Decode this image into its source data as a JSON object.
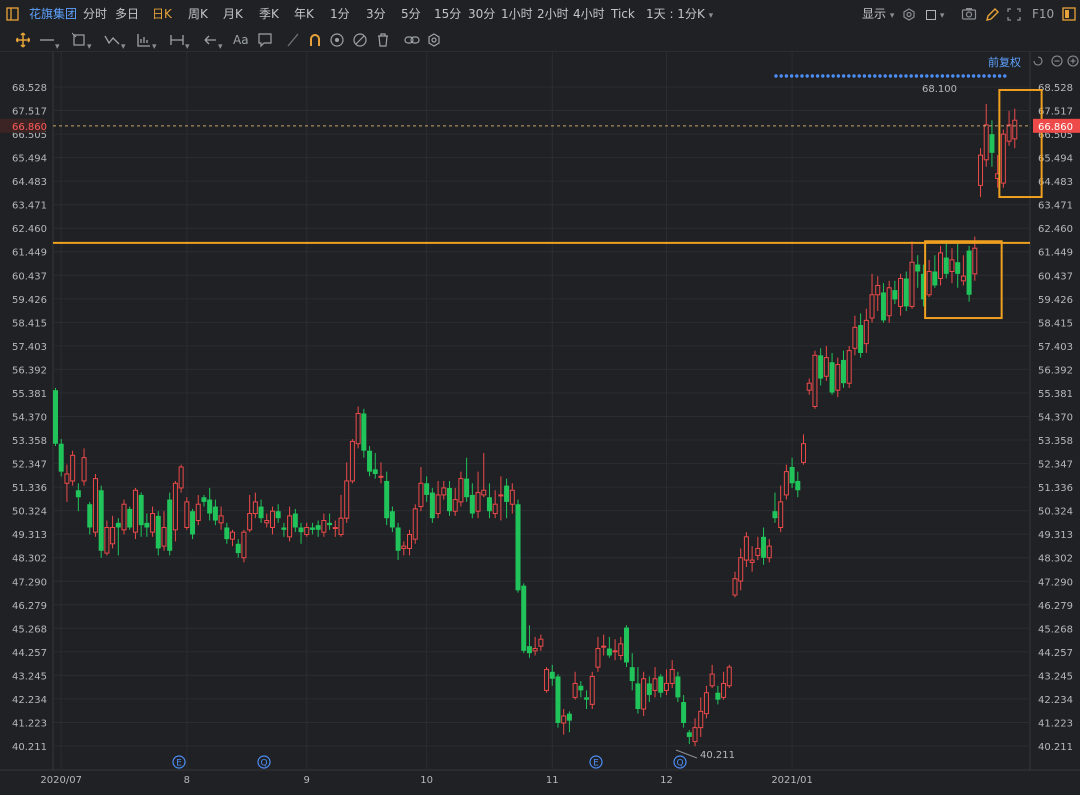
{
  "topbar": {
    "title": "花旗集团",
    "periods": [
      "分时",
      "多日",
      "日K",
      "周K",
      "月K",
      "季K",
      "年K",
      "1分",
      "3分",
      "5分",
      "15分",
      "30分",
      "1小时",
      "2小时",
      "4小时",
      "Tick"
    ],
    "active_period": "日K",
    "interval_select": "1天 : 1分K",
    "display_label": "显示",
    "f10_label": "F10"
  },
  "toolbar": {
    "text_tool_label": "Aa",
    "icons": [
      "move-icon",
      "line-icon",
      "rect-icon",
      "trend-icon",
      "chart-icon",
      "range-icon",
      "arrow-icon",
      "text-icon",
      "note-icon",
      "pen-icon",
      "magnet-icon",
      "eye-icon",
      "hide-icon",
      "trash-icon",
      "link-icon",
      "gear-icon"
    ]
  },
  "chart": {
    "adjust_label": "前复权",
    "current_price": "66.860",
    "max_label": "68.100",
    "min_label": "40.211",
    "resistance_level": 61.83,
    "event_markers": [
      {
        "glyph": "E",
        "x_index": 1
      },
      {
        "glyph": "Q",
        "x_index": 2
      },
      {
        "glyph": "E",
        "x_index": 3
      },
      {
        "glyph": "Q",
        "x_index": 4
      }
    ],
    "colors": {
      "up": "#ec4a4a",
      "down": "#20c45b",
      "highlight": "#f0a020",
      "accent_blue": "#4d8ef5"
    }
  },
  "chart_data": {
    "type": "candlestick",
    "y_ticks": [
      "68.528",
      "67.517",
      "66.505",
      "65.494",
      "64.483",
      "63.471",
      "62.460",
      "61.449",
      "60.437",
      "59.426",
      "58.415",
      "57.403",
      "56.392",
      "55.381",
      "54.370",
      "53.358",
      "52.347",
      "51.336",
      "50.324",
      "49.313",
      "48.302",
      "47.290",
      "46.279",
      "45.268",
      "44.257",
      "43.245",
      "42.234",
      "41.223",
      "40.211"
    ],
    "ylim": [
      40.211,
      68.528
    ],
    "x_ticks": [
      {
        "label": "2020/07",
        "date": "2020-07-01"
      },
      {
        "label": "8",
        "date": "2020-08-03"
      },
      {
        "label": "9",
        "date": "2020-09-01"
      },
      {
        "label": "10",
        "date": "2020-10-01"
      },
      {
        "label": "11",
        "date": "2020-11-02"
      },
      {
        "label": "12",
        "date": "2020-12-01"
      },
      {
        "label": "2021/01",
        "date": "2021-01-04"
      }
    ],
    "candles": [
      [
        55.5,
        53.2,
        55.6,
        53.1
      ],
      [
        53.2,
        52.0,
        53.4,
        51.8
      ],
      [
        51.5,
        51.9,
        52.3,
        50.7
      ],
      [
        51.6,
        52.7,
        52.9,
        51.4
      ],
      [
        51.2,
        50.9,
        51.5,
        50.3
      ],
      [
        51.6,
        52.6,
        53.0,
        51.4
      ],
      [
        50.6,
        49.6,
        50.7,
        49.3
      ],
      [
        49.4,
        51.7,
        51.9,
        49.2
      ],
      [
        51.2,
        48.6,
        51.4,
        48.3
      ],
      [
        48.5,
        49.6,
        49.9,
        48.4
      ],
      [
        48.9,
        49.6,
        50.1,
        48.7
      ],
      [
        49.8,
        49.6,
        50.0,
        48.4
      ],
      [
        49.5,
        50.6,
        50.8,
        49.3
      ],
      [
        50.4,
        49.6,
        50.5,
        49.5
      ],
      [
        49.4,
        51.2,
        51.3,
        49.1
      ],
      [
        51.0,
        49.7,
        51.1,
        49.2
      ],
      [
        49.8,
        49.6,
        50.2,
        49.2
      ],
      [
        49.4,
        50.2,
        50.5,
        49.2
      ],
      [
        50.1,
        48.7,
        50.3,
        48.4
      ],
      [
        48.8,
        49.6,
        50.3,
        48.6
      ],
      [
        50.8,
        48.6,
        51.1,
        48.4
      ],
      [
        49.5,
        51.5,
        51.6,
        49.0
      ],
      [
        51.3,
        52.2,
        52.3,
        51.1
      ],
      [
        49.6,
        50.7,
        50.9,
        49.5
      ],
      [
        50.3,
        49.3,
        50.4,
        49.1
      ],
      [
        49.9,
        50.6,
        51.0,
        49.7
      ],
      [
        50.9,
        50.7,
        51.0,
        50.5
      ],
      [
        50.8,
        50.2,
        51.3,
        49.9
      ],
      [
        50.5,
        49.9,
        50.8,
        49.7
      ],
      [
        49.8,
        50.1,
        50.5,
        49.5
      ],
      [
        49.6,
        49.1,
        49.8,
        48.9
      ],
      [
        49.1,
        49.4,
        49.5,
        48.8
      ],
      [
        48.9,
        48.5,
        49.1,
        48.3
      ],
      [
        48.3,
        49.4,
        49.5,
        48.1
      ],
      [
        49.5,
        50.2,
        51.0,
        49.4
      ],
      [
        50.2,
        50.7,
        51.1,
        50.0
      ],
      [
        50.5,
        50.0,
        50.8,
        49.8
      ],
      [
        49.8,
        49.9,
        50.2,
        49.6
      ],
      [
        49.6,
        50.3,
        50.5,
        49.3
      ],
      [
        50.3,
        50.0,
        50.6,
        49.8
      ],
      [
        49.6,
        49.5,
        49.8,
        49.2
      ],
      [
        49.2,
        50.1,
        50.5,
        49.0
      ],
      [
        50.2,
        49.6,
        50.4,
        49.4
      ],
      [
        49.6,
        49.4,
        49.8,
        48.9
      ],
      [
        49.3,
        49.6,
        49.8,
        49.2
      ],
      [
        49.6,
        49.5,
        49.8,
        49.3
      ],
      [
        49.7,
        49.5,
        49.9,
        49.2
      ],
      [
        49.4,
        49.9,
        50.2,
        49.2
      ],
      [
        49.8,
        49.7,
        50.2,
        49.5
      ],
      [
        49.6,
        49.6,
        49.9,
        49.2
      ],
      [
        49.3,
        50.0,
        51.0,
        49.2
      ],
      [
        50.0,
        51.6,
        52.4,
        49.8
      ],
      [
        51.6,
        53.3,
        53.4,
        51.5
      ],
      [
        53.2,
        54.5,
        54.8,
        53.0
      ],
      [
        54.5,
        52.9,
        54.7,
        52.6
      ],
      [
        52.9,
        52.0,
        53.1,
        51.8
      ],
      [
        52.1,
        51.9,
        52.8,
        51.7
      ],
      [
        51.8,
        51.8,
        52.4,
        51.5
      ],
      [
        51.6,
        50.0,
        52.0,
        49.7
      ],
      [
        50.3,
        49.6,
        50.5,
        49.4
      ],
      [
        49.6,
        48.6,
        49.8,
        48.2
      ],
      [
        48.7,
        48.8,
        49.0,
        48.4
      ],
      [
        48.7,
        49.3,
        49.5,
        48.4
      ],
      [
        49.1,
        50.4,
        50.6,
        48.9
      ],
      [
        50.5,
        51.5,
        52.2,
        50.3
      ],
      [
        51.5,
        51.0,
        51.8,
        50.7
      ],
      [
        51.1,
        50.0,
        51.3,
        49.8
      ],
      [
        50.2,
        51.0,
        51.6,
        50.0
      ],
      [
        51.0,
        51.3,
        51.6,
        50.8
      ],
      [
        51.3,
        50.3,
        51.6,
        50.1
      ],
      [
        50.3,
        50.8,
        51.3,
        50.1
      ],
      [
        50.7,
        51.7,
        52.0,
        50.5
      ],
      [
        51.7,
        50.9,
        52.6,
        50.7
      ],
      [
        51.0,
        50.2,
        51.5,
        50.0
      ],
      [
        50.3,
        51.1,
        52.0,
        50.0
      ],
      [
        51.0,
        51.2,
        52.8,
        50.9
      ],
      [
        50.9,
        50.3,
        51.5,
        50.0
      ],
      [
        50.2,
        50.6,
        51.2,
        50.0
      ],
      [
        51.0,
        51.0,
        51.8,
        49.9
      ],
      [
        51.4,
        50.7,
        51.7,
        50.0
      ],
      [
        50.6,
        51.2,
        51.5,
        50.2
      ],
      [
        50.6,
        46.9,
        50.8,
        46.8
      ],
      [
        47.1,
        44.3,
        47.2,
        44.2
      ],
      [
        44.5,
        44.2,
        45.4,
        44.0
      ],
      [
        44.3,
        44.4,
        44.9,
        44.1
      ],
      [
        44.5,
        44.8,
        45.0,
        44.3
      ],
      [
        42.6,
        43.5,
        43.6,
        42.5
      ],
      [
        43.4,
        43.1,
        43.7,
        42.8
      ],
      [
        43.2,
        41.2,
        43.3,
        41.0
      ],
      [
        41.2,
        41.5,
        41.8,
        40.7
      ],
      [
        41.6,
        41.3,
        41.7,
        40.8
      ],
      [
        42.3,
        42.9,
        43.4,
        42.2
      ],
      [
        42.8,
        42.6,
        43.0,
        42.3
      ],
      [
        42.3,
        42.2,
        42.6,
        41.8
      ],
      [
        42.0,
        43.2,
        43.4,
        41.8
      ],
      [
        43.6,
        44.4,
        44.9,
        43.4
      ],
      [
        44.5,
        44.5,
        45.0,
        44.1
      ],
      [
        44.4,
        44.1,
        44.9,
        44.0
      ],
      [
        44.3,
        44.3,
        44.8,
        43.9
      ],
      [
        44.1,
        44.6,
        44.9,
        43.9
      ],
      [
        45.3,
        43.8,
        45.4,
        43.6
      ],
      [
        43.6,
        43.0,
        44.2,
        42.6
      ],
      [
        42.9,
        41.8,
        43.6,
        41.6
      ],
      [
        41.8,
        43.1,
        43.4,
        41.5
      ],
      [
        42.9,
        42.4,
        43.2,
        42.1
      ],
      [
        42.6,
        43.1,
        43.6,
        42.3
      ],
      [
        43.2,
        42.5,
        43.3,
        42.3
      ],
      [
        42.6,
        42.9,
        43.5,
        42.4
      ],
      [
        42.9,
        43.5,
        43.9,
        42.7
      ],
      [
        43.2,
        42.3,
        43.4,
        42.1
      ],
      [
        42.1,
        41.2,
        42.4,
        41.0
      ],
      [
        40.8,
        40.6,
        40.9,
        40.3
      ],
      [
        40.4,
        41.0,
        41.4,
        40.2
      ],
      [
        41.0,
        41.7,
        42.3,
        40.6
      ],
      [
        41.6,
        42.5,
        42.8,
        41.4
      ],
      [
        42.8,
        43.3,
        43.7,
        42.7
      ],
      [
        42.5,
        42.2,
        42.8,
        42.0
      ],
      [
        42.3,
        42.9,
        43.4,
        42.2
      ],
      [
        42.8,
        43.6,
        43.7,
        42.7
      ],
      [
        46.7,
        47.4,
        47.7,
        46.6
      ],
      [
        47.3,
        48.3,
        48.7,
        46.9
      ],
      [
        48.2,
        49.2,
        49.4,
        47.9
      ],
      [
        48.1,
        48.2,
        48.8,
        47.7
      ],
      [
        48.4,
        48.7,
        49.2,
        48.2
      ],
      [
        49.2,
        48.3,
        49.6,
        48.0
      ],
      [
        48.3,
        48.8,
        49.1,
        48.1
      ],
      [
        50.3,
        50.0,
        51.1,
        49.8
      ],
      [
        49.6,
        50.7,
        51.4,
        49.4
      ],
      [
        51.0,
        52.0,
        52.3,
        50.8
      ],
      [
        52.2,
        51.5,
        52.6,
        51.3
      ],
      [
        51.6,
        51.2,
        52.0,
        50.9
      ],
      [
        52.4,
        53.2,
        53.6,
        52.3
      ],
      [
        55.5,
        55.8,
        56.0,
        55.3
      ],
      [
        54.8,
        57.0,
        57.2,
        54.7
      ],
      [
        57.0,
        56.0,
        57.3,
        55.7
      ],
      [
        56.1,
        56.9,
        57.4,
        55.9
      ],
      [
        56.7,
        55.4,
        57.1,
        55.3
      ],
      [
        55.5,
        56.6,
        56.9,
        55.2
      ],
      [
        56.8,
        55.8,
        57.2,
        55.6
      ],
      [
        55.8,
        57.2,
        57.4,
        55.6
      ],
      [
        57.3,
        58.2,
        58.7,
        57.0
      ],
      [
        58.3,
        57.1,
        58.8,
        56.9
      ],
      [
        57.5,
        58.5,
        59.0,
        57.1
      ],
      [
        58.6,
        59.6,
        60.5,
        58.4
      ],
      [
        59.6,
        60.0,
        60.4,
        58.9
      ],
      [
        59.7,
        58.5,
        60.1,
        58.4
      ],
      [
        58.7,
        59.9,
        60.2,
        58.4
      ],
      [
        59.8,
        59.4,
        60.2,
        59.2
      ],
      [
        59.1,
        60.3,
        60.5,
        58.7
      ],
      [
        60.3,
        59.1,
        60.6,
        58.9
      ],
      [
        59.1,
        61.0,
        61.9,
        59.0
      ],
      [
        60.9,
        60.6,
        61.3,
        59.9
      ],
      [
        60.5,
        59.4,
        60.9,
        59.1
      ],
      [
        59.6,
        60.6,
        61.1,
        59.5
      ],
      [
        60.6,
        60.0,
        61.3,
        59.9
      ],
      [
        60.3,
        61.4,
        61.7,
        60.0
      ],
      [
        61.2,
        60.5,
        61.8,
        60.3
      ],
      [
        60.6,
        61.1,
        61.6,
        60.1
      ],
      [
        61.0,
        60.5,
        61.8,
        59.9
      ],
      [
        60.2,
        60.4,
        61.3,
        60.0
      ],
      [
        61.5,
        59.6,
        61.7,
        59.3
      ],
      [
        60.5,
        61.6,
        62.1,
        60.2
      ],
      [
        64.3,
        65.6,
        65.9,
        63.8
      ],
      [
        65.4,
        66.9,
        67.8,
        65.1
      ],
      [
        66.5,
        65.7,
        67.1,
        65.1
      ],
      [
        64.6,
        64.8,
        65.6,
        64.2
      ],
      [
        64.4,
        66.5,
        66.7,
        64.2
      ],
      [
        66.2,
        66.9,
        67.5,
        66.0
      ],
      [
        66.3,
        67.1,
        67.6,
        65.9
      ]
    ],
    "dates": [
      "2020-06-30",
      "2020-07-01",
      "2020-07-02",
      "2020-07-06",
      "2020-07-07",
      "2020-07-08",
      "2020-07-09",
      "2020-07-10",
      "2020-07-13",
      "2020-07-14",
      "2020-07-15",
      "2020-07-16",
      "2020-07-17",
      "2020-07-20",
      "2020-07-21",
      "2020-07-22",
      "2020-07-23",
      "2020-07-24",
      "2020-07-27",
      "2020-07-28",
      "2020-07-29",
      "2020-07-30",
      "2020-07-31",
      "2020-08-03",
      "2020-08-04",
      "2020-08-05",
      "2020-08-06",
      "2020-08-07",
      "2020-08-10",
      "2020-08-11",
      "2020-08-12",
      "2020-08-13",
      "2020-08-14",
      "2020-08-17",
      "2020-08-18",
      "2020-08-19",
      "2020-08-20",
      "2020-08-21",
      "2020-08-24",
      "2020-08-25",
      "2020-08-26",
      "2020-08-27",
      "2020-08-28",
      "2020-08-31",
      "2020-09-01",
      "2020-09-02",
      "2020-09-03",
      "2020-09-04",
      "2020-09-08",
      "2020-09-09",
      "2020-09-10",
      "2020-09-11",
      "2020-09-14",
      "2020-09-15",
      "2020-09-16",
      "2020-09-17",
      "2020-09-18",
      "2020-09-21",
      "2020-09-22",
      "2020-09-23",
      "2020-09-24",
      "2020-09-25",
      "2020-09-28",
      "2020-09-29",
      "2020-09-30",
      "2020-10-01",
      "2020-10-02",
      "2020-10-05",
      "2020-10-06",
      "2020-10-07",
      "2020-10-08",
      "2020-10-09",
      "2020-10-12",
      "2020-10-13",
      "2020-10-14",
      "2020-10-15",
      "2020-10-16",
      "2020-10-19",
      "2020-10-20",
      "2020-10-21",
      "2020-10-22",
      "2020-10-23",
      "2020-10-26",
      "2020-10-27",
      "2020-10-28",
      "2020-10-29",
      "2020-10-30",
      "2020-11-02",
      "2020-11-03",
      "2020-11-04",
      "2020-11-05",
      "2020-11-06",
      "2020-11-09",
      "2020-11-10",
      "2020-11-11",
      "2020-11-12",
      "2020-11-13",
      "2020-11-16",
      "2020-11-17",
      "2020-11-18",
      "2020-11-19",
      "2020-11-20",
      "2020-11-23",
      "2020-11-24",
      "2020-11-25",
      "2020-11-27",
      "2020-11-30",
      "2020-12-01",
      "2020-12-02",
      "2020-12-03",
      "2020-12-04",
      "2020-12-07",
      "2020-12-08",
      "2020-12-09",
      "2020-12-10",
      "2020-12-11",
      "2020-12-14",
      "2020-12-15",
      "2020-12-16",
      "2020-12-17",
      "2020-12-18",
      "2020-12-21",
      "2020-12-22",
      "2020-12-23",
      "2020-12-24",
      "2020-12-28",
      "2020-12-29",
      "2020-12-30",
      "2020-12-31",
      "2021-01-04",
      "2021-01-05",
      "2021-01-06",
      "2021-01-07",
      "2021-01-08",
      "2021-01-11",
      "2021-01-12",
      "2021-01-13",
      "2021-01-14",
      "2021-01-15",
      "2021-01-19",
      "2021-01-20",
      "2021-01-21",
      "2021-01-22",
      "2021-01-25",
      "2021-01-26",
      "2021-01-27",
      "2021-01-28",
      "2021-01-29",
      "2021-02-01",
      "2021-02-02",
      "2021-02-03",
      "2021-02-04",
      "2021-02-05",
      "2021-02-08",
      "2021-02-09",
      "2021-02-10",
      "2021-02-11",
      "2021-02-12",
      "2021-02-16",
      "2021-02-17",
      "2021-02-18",
      "2021-02-19",
      "2021-02-22",
      "2021-02-23",
      "2021-02-24",
      "2021-02-25",
      "2021-02-26",
      "2021-03-01",
      "2021-03-02",
      "2021-03-03",
      "2021-03-04",
      "2021-03-05",
      "2021-03-08",
      "2021-03-09",
      "2021-03-10"
    ],
    "candle_fields": [
      "open",
      "close",
      "high",
      "low"
    ],
    "grid": true,
    "highlight_boxes": [
      {
        "from_index": 153,
        "to_index": 165,
        "y_range": [
          58.6,
          61.9
        ]
      },
      {
        "from_index": 166,
        "to_index": 172,
        "y_range": [
          63.8,
          68.4
        ]
      }
    ]
  }
}
